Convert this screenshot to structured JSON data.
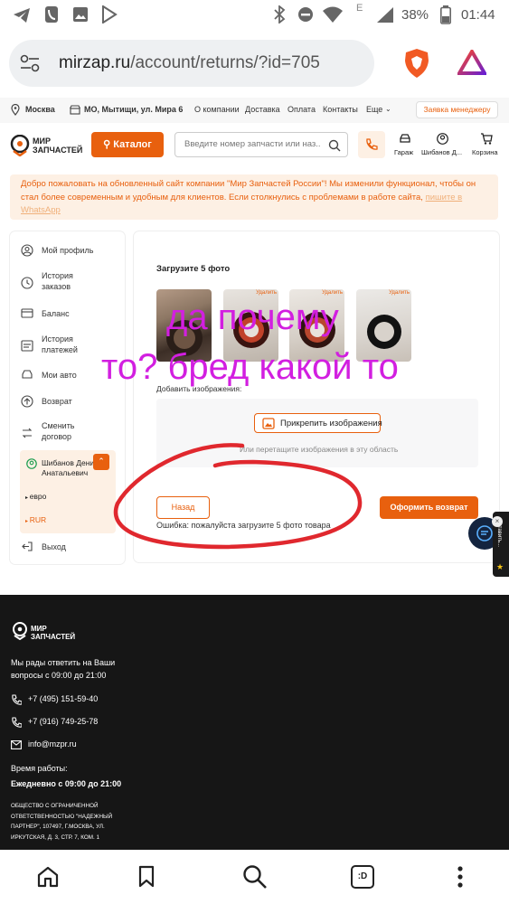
{
  "status_bar": {
    "time": "01:44",
    "battery": "38%",
    "network": "E"
  },
  "browser": {
    "url_host": "mirzap.ru",
    "url_path": "/account/returns/?id=705"
  },
  "top_info": {
    "city": "Москва",
    "store": "МО, Мытищи, ул. Мира 6",
    "links": [
      "О компании",
      "Доставка",
      "Оплата",
      "Контакты",
      "Еще"
    ],
    "manager_button": "Заявка менеджеру"
  },
  "header": {
    "logo_line1": "МИР",
    "logo_line2": "ЗАПЧАСТЕЙ",
    "catalog_label": "Каталог",
    "search_placeholder": "Введите номер запчасти или наз...",
    "garage_label": "Гараж",
    "user_label": "Шибанов Д...",
    "cart_label": "Корзина"
  },
  "notice": {
    "text": "Добро пожаловать на обновленный сайт компании \"Мир Запчастей России\"! Мы изменили функционал, чтобы он стал более современным и удобным для клиентов. Если столкнулись с проблемами в работе сайта,",
    "link_text": "пишите в WhatsApp"
  },
  "sidebar": {
    "items": [
      {
        "label": "Мой профиль",
        "icon": "user-icon"
      },
      {
        "label": "История заказов",
        "icon": "history-icon"
      },
      {
        "label": "Баланс",
        "icon": "wallet-icon"
      },
      {
        "label": "История платежей",
        "icon": "payments-icon"
      },
      {
        "label": "Мои авто",
        "icon": "car-icon"
      },
      {
        "label": "Возврат",
        "icon": "return-icon"
      },
      {
        "label": "Сменить договор",
        "icon": "switch-icon"
      }
    ],
    "contract": {
      "name": "Шибанов Денис Анатальевич",
      "options": [
        "евро",
        "RUR"
      ],
      "selected": "RUR"
    },
    "logout_label": "Выход"
  },
  "returns": {
    "upload_title": "Загрузите 5 фото",
    "delete_label": "Удалить",
    "add_images_label": "Добавить изображения:",
    "attach_button": "Прикрепить изображения",
    "drop_hint": "Или перетащите изображения в эту область",
    "back_button": "Назад",
    "submit_button": "Оформить возврат",
    "error_text": "Ошибка: пожалуйста загрузите 5 фото товара"
  },
  "annotation": {
    "line1": "да почему",
    "line2": "то? бред какой то",
    "color": "#d21fe0",
    "circle_color": "#e0282e"
  },
  "side_widget": {
    "label": "Оставить..."
  },
  "footer": {
    "logo_line1": "МИР",
    "logo_line2": "ЗАПЧАСТЕЙ",
    "tagline_line1": "Мы рады ответить на Ваши",
    "tagline_line2": "вопросы с 09:00 до 21:00",
    "phone1": "+7 (495) 151-59-40",
    "phone2": "+7 (916) 749-25-78",
    "email": "info@mzpr.ru",
    "hours_title": "Время работы:",
    "hours_value": "Ежедневно с 09:00 до 21:00",
    "legal_line1": "ОБЩЕСТВО С ОГРАНИЧЕННОЙ",
    "legal_line2": "ОТВЕТСТВЕННОСТЬЮ \"НАДЕЖНЫЙ",
    "legal_line3": "ПАРТНЕР\", 107497, Г.МОСКВА, УЛ.",
    "legal_line4": "ИРКУТСКАЯ, Д. 3, СТР. 7, КОМ. 1"
  },
  "colors": {
    "accent": "#e8600e",
    "footer_bg": "#161616",
    "notice_bg": "#fdf0e4"
  }
}
